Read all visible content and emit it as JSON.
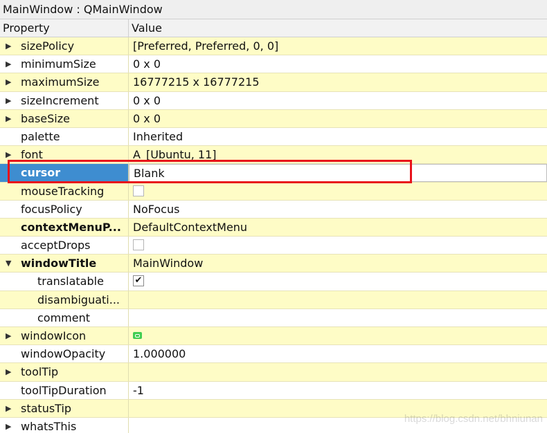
{
  "window": {
    "title": "MainWindow : QMainWindow"
  },
  "header": {
    "property": "Property",
    "value": "Value"
  },
  "colors": {
    "row_yellow": "#fefcc6",
    "row_white": "#ffffff",
    "selected_bg": "#3e8dd0",
    "highlight_border": "#e8121b"
  },
  "properties": [
    {
      "name": "sizePolicy",
      "value": "[Preferred, Preferred, 0, 0]",
      "expandable": true,
      "expanded": false,
      "bold": false,
      "indent": false,
      "type": "text"
    },
    {
      "name": "minimumSize",
      "value": "0 x 0",
      "expandable": true,
      "expanded": false,
      "bold": false,
      "indent": false,
      "type": "text"
    },
    {
      "name": "maximumSize",
      "value": "16777215 x 16777215",
      "expandable": true,
      "expanded": false,
      "bold": false,
      "indent": false,
      "type": "text"
    },
    {
      "name": "sizeIncrement",
      "value": "0 x 0",
      "expandable": true,
      "expanded": false,
      "bold": false,
      "indent": false,
      "type": "text"
    },
    {
      "name": "baseSize",
      "value": "0 x 0",
      "expandable": true,
      "expanded": false,
      "bold": false,
      "indent": false,
      "type": "text"
    },
    {
      "name": "palette",
      "value": "Inherited",
      "expandable": false,
      "expanded": false,
      "bold": false,
      "indent": false,
      "type": "text"
    },
    {
      "name": "font",
      "value": "[Ubuntu, 11]",
      "glyph": "A",
      "expandable": true,
      "expanded": false,
      "bold": false,
      "indent": false,
      "type": "font"
    },
    {
      "name": "cursor",
      "value": "Blank",
      "expandable": false,
      "expanded": false,
      "bold": true,
      "indent": false,
      "type": "text",
      "selected": true
    },
    {
      "name": "mouseTracking",
      "value": "",
      "expandable": false,
      "expanded": false,
      "bold": false,
      "indent": false,
      "type": "checkbox",
      "checked": false
    },
    {
      "name": "focusPolicy",
      "value": "NoFocus",
      "expandable": false,
      "expanded": false,
      "bold": false,
      "indent": false,
      "type": "text"
    },
    {
      "name": "contextMenuP...",
      "value": "DefaultContextMenu",
      "expandable": false,
      "expanded": false,
      "bold": true,
      "indent": false,
      "type": "text"
    },
    {
      "name": "acceptDrops",
      "value": "",
      "expandable": false,
      "expanded": false,
      "bold": false,
      "indent": false,
      "type": "checkbox",
      "checked": false
    },
    {
      "name": "windowTitle",
      "value": "MainWindow",
      "expandable": true,
      "expanded": true,
      "bold": true,
      "indent": false,
      "type": "text"
    },
    {
      "name": "translatable",
      "value": "",
      "expandable": false,
      "expanded": false,
      "bold": false,
      "indent": true,
      "type": "checkbox",
      "checked": true
    },
    {
      "name": "disambiguati...",
      "value": "",
      "expandable": false,
      "expanded": false,
      "bold": false,
      "indent": true,
      "type": "text"
    },
    {
      "name": "comment",
      "value": "",
      "expandable": false,
      "expanded": false,
      "bold": false,
      "indent": true,
      "type": "text"
    },
    {
      "name": "windowIcon",
      "value": "",
      "expandable": true,
      "expanded": false,
      "bold": false,
      "indent": false,
      "type": "icon",
      "icon": "qt-logo-icon"
    },
    {
      "name": "windowOpacity",
      "value": "1.000000",
      "expandable": false,
      "expanded": false,
      "bold": false,
      "indent": false,
      "type": "text"
    },
    {
      "name": "toolTip",
      "value": "",
      "expandable": true,
      "expanded": false,
      "bold": false,
      "indent": false,
      "type": "text"
    },
    {
      "name": "toolTipDuration",
      "value": "-1",
      "expandable": false,
      "expanded": false,
      "bold": false,
      "indent": false,
      "type": "text"
    },
    {
      "name": "statusTip",
      "value": "",
      "expandable": true,
      "expanded": false,
      "bold": false,
      "indent": false,
      "type": "text"
    },
    {
      "name": "whatsThis",
      "value": "",
      "expandable": true,
      "expanded": false,
      "bold": false,
      "indent": false,
      "type": "text"
    }
  ],
  "watermark": "https://blog.csdn.net/bhniunan"
}
